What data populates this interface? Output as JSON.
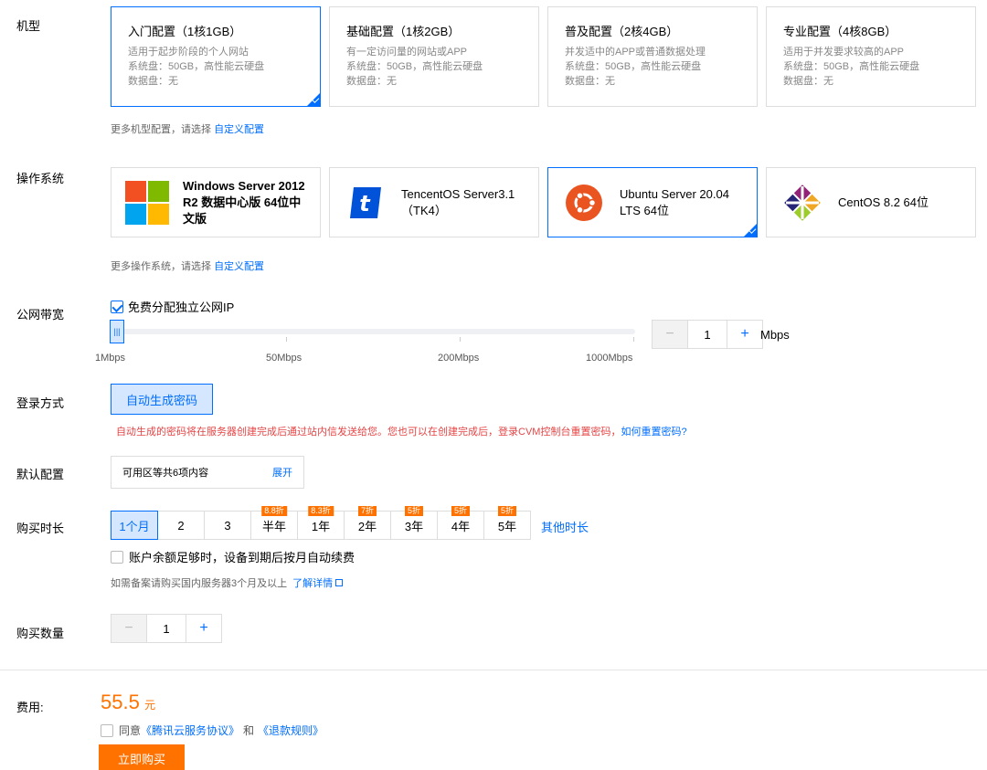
{
  "labels": {
    "model": "机型",
    "os": "操作系统",
    "bandwidth": "公网带宽",
    "login": "登录方式",
    "default_config": "默认配置",
    "duration": "购买时长",
    "quantity": "购买数量",
    "fee": "费用:"
  },
  "models": [
    {
      "title": "入门配置（1核1GB）",
      "l1": "适用于起步阶段的个人网站",
      "l2": "系统盘：50GB，高性能云硬盘",
      "l3": "数据盘：无",
      "selected": true
    },
    {
      "title": "基础配置（1核2GB）",
      "l1": "有一定访问量的网站或APP",
      "l2": "系统盘：50GB，高性能云硬盘",
      "l3": "数据盘：无",
      "selected": false
    },
    {
      "title": "普及配置（2核4GB）",
      "l1": "并发适中的APP或普通数据处理",
      "l2": "系统盘：50GB，高性能云硬盘",
      "l3": "数据盘：无",
      "selected": false
    },
    {
      "title": "专业配置（4核8GB）",
      "l1": "适用于并发要求较高的APP",
      "l2": "系统盘：50GB，高性能云硬盘",
      "l3": "数据盘：无",
      "selected": false
    }
  ],
  "model_hint": {
    "text": "更多机型配置，请选择",
    "link": "自定义配置"
  },
  "os": [
    {
      "l1": "Windows Server 2012",
      "l2": "R2 数据中心版 64位中",
      "l3": "文版",
      "icon": "windows-logo-icon",
      "selected": false
    },
    {
      "l1": "TencentOS Server3.1",
      "l2": "（TK4）",
      "l3": "",
      "icon": "tencentos-logo-icon",
      "selected": false
    },
    {
      "l1": "Ubuntu Server 20.04",
      "l2": "LTS 64位",
      "l3": "",
      "icon": "ubuntu-logo-icon",
      "selected": true
    },
    {
      "l1": "CentOS 8.2 64位",
      "l2": "",
      "l3": "",
      "icon": "centos-logo-icon",
      "selected": false
    }
  ],
  "os_hint": {
    "text": "更多操作系统，请选择",
    "link": "自定义配置"
  },
  "bandwidth": {
    "checkbox_label": "免费分配独立公网IP",
    "checked": true,
    "ticks": [
      "1Mbps",
      "50Mbps",
      "200Mbps",
      "1000Mbps"
    ],
    "value": "1",
    "minus": "−",
    "plus": "+",
    "unit": "Mbps"
  },
  "login": {
    "button": "自动生成密码",
    "notice": "自动生成的密码将在服务器创建完成后通过站内信发送给您。您也可以在创建完成后，登录CVM控制台重置密码，",
    "link": "如何重置密码?"
  },
  "default_config": {
    "text": "可用区等共6项内容",
    "expand": "展开"
  },
  "duration": {
    "options": [
      {
        "label": "1个月",
        "badge": "",
        "selected": true
      },
      {
        "label": "2",
        "badge": "",
        "selected": false
      },
      {
        "label": "3",
        "badge": "",
        "selected": false
      },
      {
        "label": "半年",
        "badge": "8.8折",
        "selected": false
      },
      {
        "label": "1年",
        "badge": "8.3折",
        "selected": false
      },
      {
        "label": "2年",
        "badge": "7折",
        "selected": false
      },
      {
        "label": "3年",
        "badge": "5折",
        "selected": false
      },
      {
        "label": "4年",
        "badge": "5折",
        "selected": false
      },
      {
        "label": "5年",
        "badge": "5折",
        "selected": false
      }
    ],
    "other": "其他时长",
    "autorenew": "账户余额足够时，设备到期后按月自动续费",
    "note": "如需备案请购买国内服务器3个月及以上",
    "note_link": "了解详情"
  },
  "quantity": {
    "value": "1",
    "minus": "−",
    "plus": "+"
  },
  "footer": {
    "price": "55.5",
    "currency": "元",
    "agree_prefix": "同意",
    "agree_link1": "《腾讯云服务协议》",
    "agree_and": "和",
    "agree_link2": "《退款规则》",
    "buy": "立即购买"
  },
  "colors": {
    "accent": "#006eff",
    "orange": "#ff7200",
    "warning": "#e54545"
  }
}
